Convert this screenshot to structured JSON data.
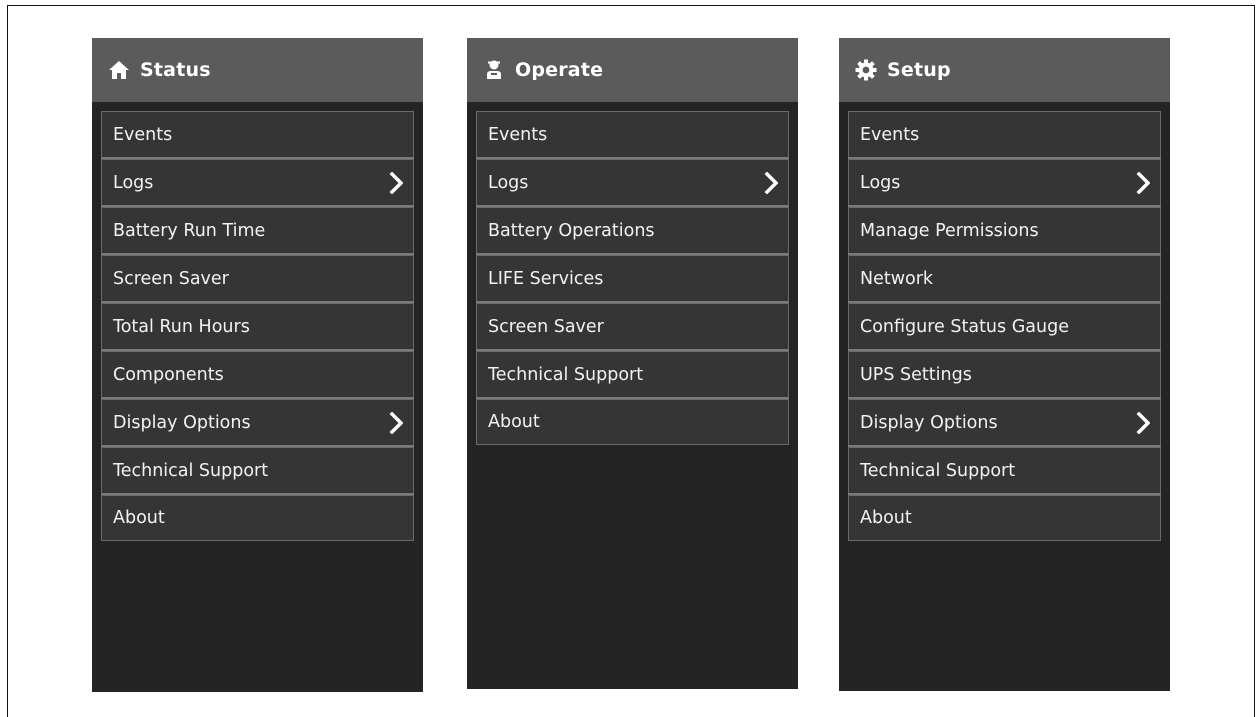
{
  "panels": [
    {
      "title": "Status",
      "icon": "home-icon",
      "items": [
        {
          "label": "Events",
          "has_submenu": false
        },
        {
          "label": "Logs",
          "has_submenu": true
        },
        {
          "label": "Battery Run Time",
          "has_submenu": false
        },
        {
          "label": "Screen Saver",
          "has_submenu": false
        },
        {
          "label": "Total Run Hours",
          "has_submenu": false
        },
        {
          "label": "Components",
          "has_submenu": false
        },
        {
          "label": "Display Options",
          "has_submenu": true
        },
        {
          "label": "Technical Support",
          "has_submenu": false
        },
        {
          "label": "About",
          "has_submenu": false
        }
      ]
    },
    {
      "title": "Operate",
      "icon": "operator-icon",
      "items": [
        {
          "label": "Events",
          "has_submenu": false
        },
        {
          "label": "Logs",
          "has_submenu": true
        },
        {
          "label": "Battery Operations",
          "has_submenu": false
        },
        {
          "label": "LIFE Services",
          "has_submenu": false
        },
        {
          "label": "Screen Saver",
          "has_submenu": false
        },
        {
          "label": "Technical Support",
          "has_submenu": false
        },
        {
          "label": "About",
          "has_submenu": false
        }
      ]
    },
    {
      "title": "Setup",
      "icon": "gear-icon",
      "items": [
        {
          "label": "Events",
          "has_submenu": false
        },
        {
          "label": "Logs",
          "has_submenu": true
        },
        {
          "label": "Manage Permissions",
          "has_submenu": false
        },
        {
          "label": "Network",
          "has_submenu": false
        },
        {
          "label": "Configure Status Gauge",
          "has_submenu": false
        },
        {
          "label": "UPS Settings",
          "has_submenu": false
        },
        {
          "label": "Display Options",
          "has_submenu": true
        },
        {
          "label": "Technical Support",
          "has_submenu": false
        },
        {
          "label": "About",
          "has_submenu": false
        }
      ]
    }
  ],
  "colors": {
    "panel_bg": "#242424",
    "header_bg": "#5b5b5b",
    "item_bg": "#353535",
    "text": "#f2f2f2"
  }
}
